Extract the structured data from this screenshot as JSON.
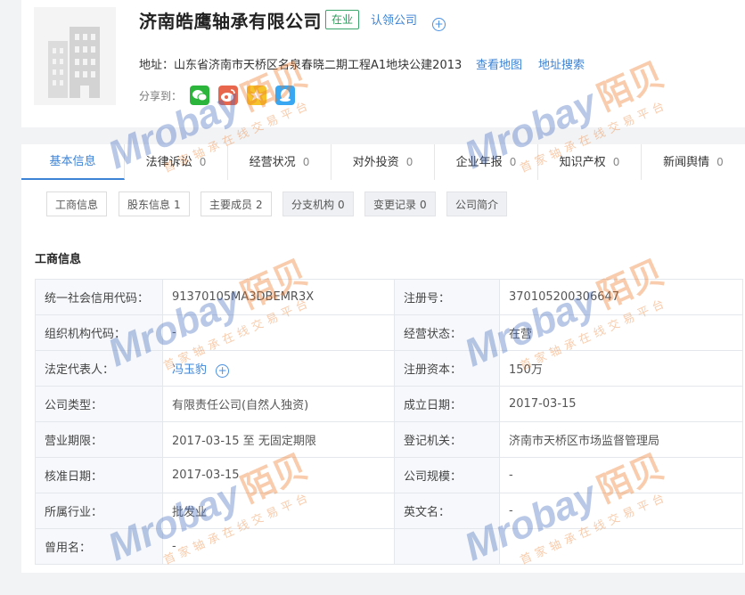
{
  "company": {
    "name": "济南皓鹰轴承有限公司",
    "status_tag": "在业",
    "claim_link": "认领公司",
    "address_label": "地址：",
    "address": "山东省济南市天桥区名泉春晓二期工程A1地块公建2013",
    "map_link": "查看地图",
    "address_search_link": "地址搜索",
    "share_label": "分享到："
  },
  "share_buttons": [
    {
      "name": "wechat",
      "color": "#2bb53b"
    },
    {
      "name": "weibo",
      "color": "#e8674c"
    },
    {
      "name": "qzone",
      "color": "#f5c22c"
    },
    {
      "name": "qq",
      "color": "#3aa7f2"
    }
  ],
  "tabs": [
    {
      "label": "基本信息",
      "count": ""
    },
    {
      "label": "法律诉讼",
      "count": "0"
    },
    {
      "label": "经营状况",
      "count": "0"
    },
    {
      "label": "对外投资",
      "count": "0"
    },
    {
      "label": "企业年报",
      "count": "0"
    },
    {
      "label": "知识产权",
      "count": "0"
    },
    {
      "label": "新闻舆情",
      "count": "0"
    }
  ],
  "subtabs": [
    {
      "label": "工商信息",
      "count": ""
    },
    {
      "label": "股东信息",
      "count": "1"
    },
    {
      "label": "主要成员",
      "count": "2"
    },
    {
      "label": "分支机构",
      "count": "0"
    },
    {
      "label": "变更记录",
      "count": "0"
    },
    {
      "label": "公司简介",
      "count": ""
    }
  ],
  "section_title": "工商信息",
  "info_rows": [
    {
      "l1": "统一社会信用代码：",
      "v1": "91370105MA3DBEMR3X",
      "l2": "注册号：",
      "v2": "370105200306647"
    },
    {
      "l1": "组织机构代码：",
      "v1": "-",
      "l2": "经营状态：",
      "v2": "在营"
    },
    {
      "l1": "法定代表人：",
      "v1": "冯玉豹",
      "l2": "注册资本：",
      "v2": "150万"
    },
    {
      "l1": "公司类型：",
      "v1": "有限责任公司(自然人独资)",
      "l2": "成立日期：",
      "v2": "2017-03-15"
    },
    {
      "l1": "营业期限：",
      "v1": "2017-03-15 至 无固定期限",
      "l2": "登记机关：",
      "v2": "济南市天桥区市场监督管理局"
    },
    {
      "l1": "核准日期：",
      "v1": "2017-03-15",
      "l2": "公司规模：",
      "v2": "-"
    },
    {
      "l1": "所属行业：",
      "v1": "批发业",
      "l2": "英文名：",
      "v2": "-"
    },
    {
      "l1": "曾用名：",
      "v1": "-",
      "l2": "",
      "v2": ""
    }
  ],
  "watermark": {
    "brand": "Mrobay",
    "cn": "陌贝",
    "slogan": "首家轴承在线交易平台"
  },
  "colors": {
    "link": "#3c83d6",
    "status_green": "#2e9a5c",
    "label_bg": "#f6f8fb"
  }
}
